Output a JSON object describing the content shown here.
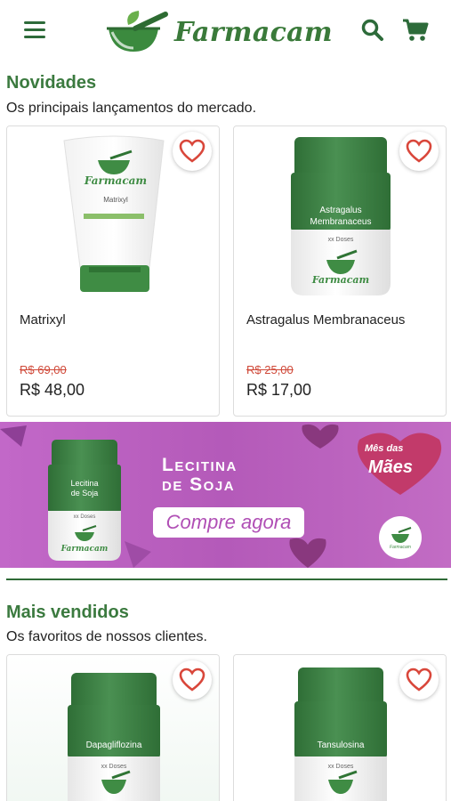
{
  "header": {
    "brand": "Farmacam",
    "icons": {
      "menu": "menu-icon",
      "search": "search-icon",
      "cart": "cart-icon"
    }
  },
  "sections": [
    {
      "title": "Novidades",
      "subtitle": "Os principais lançamentos do mercado.",
      "products": [
        {
          "name": "Matrixyl",
          "old_price": "R$ 69,00",
          "price": "R$ 48,00",
          "label_brand": "Farmacam",
          "label_name": "Matrixyl"
        },
        {
          "name": "Astragalus Membranaceus",
          "old_price": "R$ 25,00",
          "price": "R$ 17,00",
          "label_line1": "Astragalus",
          "label_line2": "Membranaceus",
          "label_doses": "xx Doses",
          "label_brand": "Farmacam"
        }
      ]
    },
    {
      "title": "Mais vendidos",
      "subtitle": "Os favoritos de nossos clientes.",
      "products": [
        {
          "label_name": "Dapagliflozina",
          "label_doses": "xx Doses"
        },
        {
          "label_name": "Tansulosina",
          "label_doses": "xx Doses"
        }
      ]
    }
  ],
  "banner": {
    "title_line1": "Lecitina",
    "title_line2": "de Soja",
    "cta": "Compre agora",
    "jar_line1": "Lecitina",
    "jar_line2": "de Soja",
    "jar_doses": "xx Doses",
    "jar_brand": "Farmacam",
    "badge_line1": "Mês das",
    "badge_line2": "Mães",
    "corner_brand": "Farmacam"
  },
  "colors": {
    "brand_green": "#3b7a3f",
    "jar_green": "#3f7f46",
    "banner_purple": "#b75cbd",
    "favorite_red": "#d9473b",
    "old_price": "#d04a3a"
  }
}
